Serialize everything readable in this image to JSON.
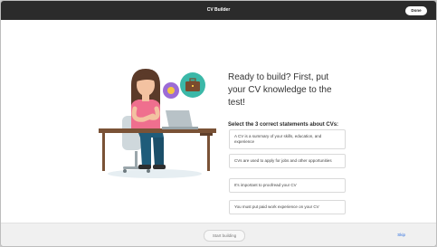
{
  "window": {
    "title": "CV Builder"
  },
  "header": {
    "done_label": "Done"
  },
  "main": {
    "heading": "Ready to build? First, put your CV knowledge to the test!",
    "instruction": "Select the 3 correct statements about CVs:",
    "options": [
      {
        "text": "A CV is a summary of your skills, education, and experience"
      },
      {
        "text": "CVs are used to apply for jobs and other opportunities"
      },
      {
        "text": "It's important to proofread your CV"
      },
      {
        "text": "You must put paid work experience on your CV"
      }
    ]
  },
  "footer": {
    "start_label": "Start building",
    "skip_label": "Skip"
  },
  "colors": {
    "titlebar": "#2b2b2b",
    "accent_link": "#2b6de0",
    "option_border": "#d9d9d9"
  },
  "icons": [
    "briefcase-icon",
    "coin-icon"
  ]
}
